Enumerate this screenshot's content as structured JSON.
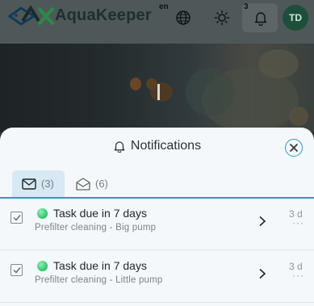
{
  "header": {
    "brand_prefix": "Aqua",
    "brand_suffix": "Keeper",
    "language": "en",
    "notification_count": "3",
    "avatar_initials": "TD",
    "icons": [
      "logo-fish-icon",
      "globe-icon",
      "sun-icon",
      "bell-icon"
    ]
  },
  "panel": {
    "title": "Notifications",
    "tabs": [
      {
        "label": "(3)",
        "icon": "envelope-closed-icon",
        "active": true
      },
      {
        "label": "(6)",
        "icon": "envelope-open-icon",
        "active": false
      }
    ],
    "items": [
      {
        "title": "Task due in 7 days",
        "subtitle": "Prefilter cleaning - Big pump",
        "time": "3 d",
        "more": "···"
      },
      {
        "title": "Task due in 7 days",
        "subtitle": "Prefilter cleaning - Little pump",
        "time": "3 d",
        "more": "···"
      }
    ]
  },
  "colors": {
    "accent": "#2a9cc4",
    "status_dot": "#3fcf78",
    "active_tab_bg": "#d6e9f4",
    "avatar_bg": "#1d4f3a"
  }
}
